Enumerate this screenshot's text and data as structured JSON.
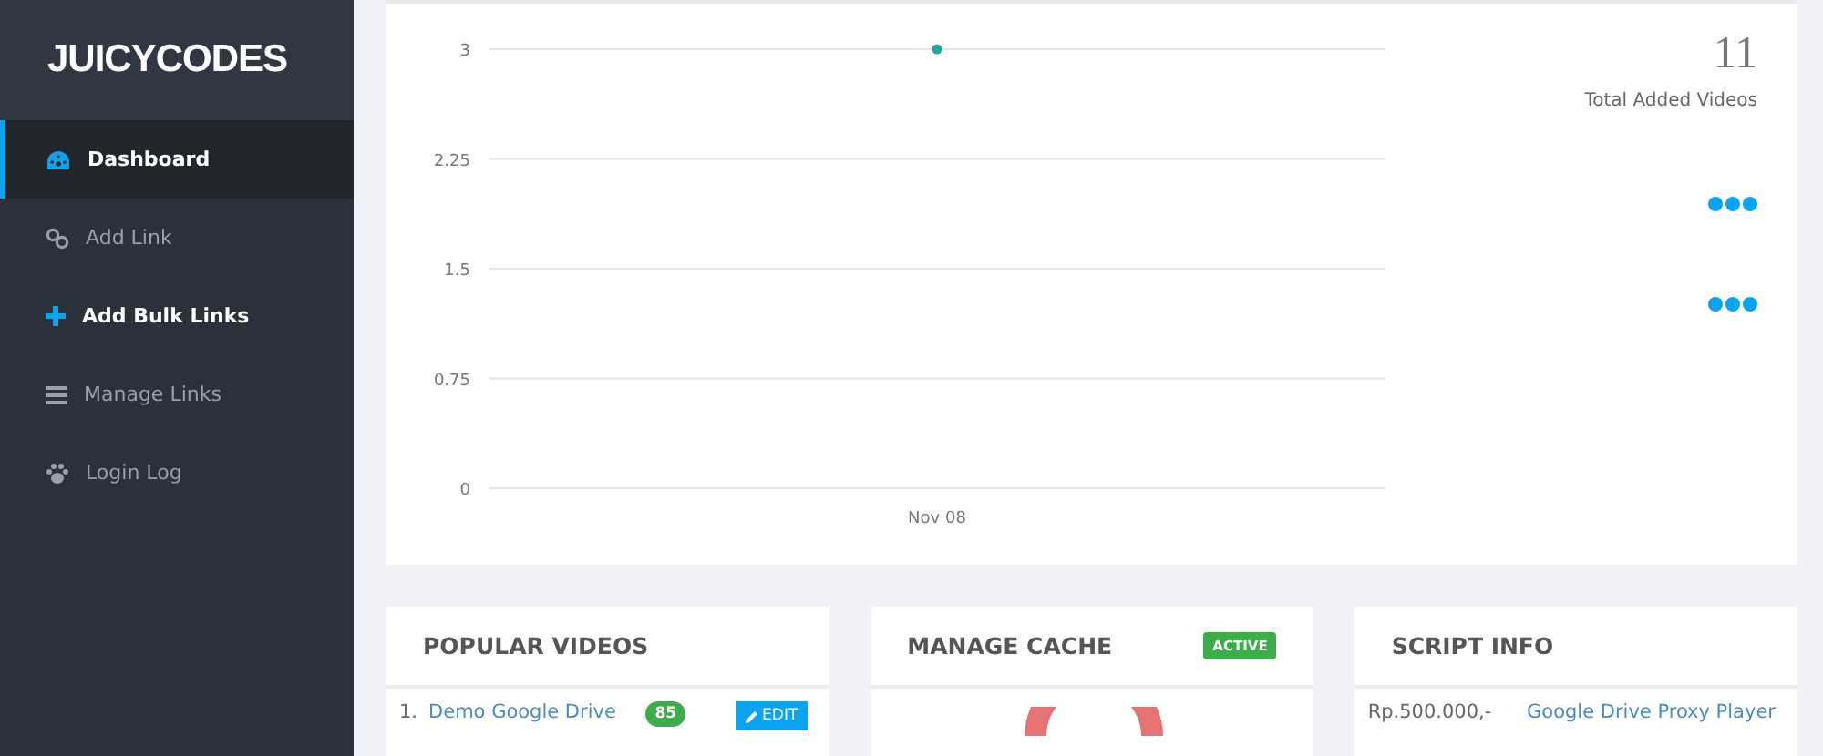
{
  "sidebar": {
    "logo": "JUICYCODES",
    "items": [
      {
        "label": "Dashboard",
        "selected": true,
        "hovered": false
      },
      {
        "label": "Add Link",
        "selected": false,
        "hovered": false
      },
      {
        "label": "Add Bulk Links",
        "selected": false,
        "hovered": true
      },
      {
        "label": "Manage Links",
        "selected": false,
        "hovered": false
      },
      {
        "label": "Login Log",
        "selected": false,
        "hovered": false
      }
    ]
  },
  "chart_card": {
    "chart_data": {
      "type": "line",
      "categories": [
        "Nov 08"
      ],
      "series": [
        {
          "color": "#26a69a",
          "values": [
            3
          ],
          "marker": true
        }
      ],
      "grid": true,
      "ylim": [
        0,
        3
      ],
      "yticks": [
        0,
        0.75,
        1.5,
        2.25,
        3
      ]
    },
    "total": "11",
    "total_label": "Total Added Videos"
  },
  "popular_videos": {
    "title": "POPULAR VIDEOS",
    "rows": [
      {
        "index": "1.",
        "title": "Demo Google Drive",
        "count": "85",
        "action": "EDIT"
      }
    ]
  },
  "manage_cache": {
    "title": "MANAGE CACHE",
    "status": "ACTIVE"
  },
  "script_info": {
    "title": "SCRIPT INFO",
    "rows": [
      {
        "price": "Rp.500.000,-",
        "product": "Google Drive Proxy Player"
      }
    ]
  }
}
